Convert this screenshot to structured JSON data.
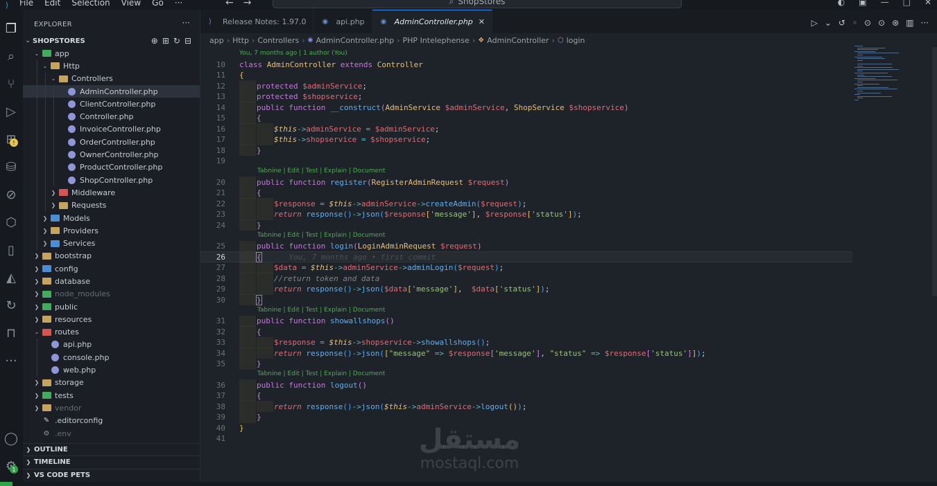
{
  "menu": [
    "File",
    "Edit",
    "Selection",
    "View",
    "Go",
    "···"
  ],
  "search": {
    "text": "ShopStores"
  },
  "explorer": {
    "title": "EXPLORER",
    "root": "SHOPSTORES",
    "tree": [
      {
        "label": "app",
        "depth": 0,
        "open": true,
        "kind": "folder",
        "color": "green"
      },
      {
        "label": "Http",
        "depth": 1,
        "open": true,
        "kind": "folder",
        "color": "yellow"
      },
      {
        "label": "Controllers",
        "depth": 2,
        "open": true,
        "kind": "folder",
        "color": "yellow"
      },
      {
        "label": "AdminController.php",
        "depth": 3,
        "kind": "php",
        "selected": true
      },
      {
        "label": "ClientController.php",
        "depth": 3,
        "kind": "php"
      },
      {
        "label": "Controller.php",
        "depth": 3,
        "kind": "php"
      },
      {
        "label": "InvoiceController.php",
        "depth": 3,
        "kind": "php"
      },
      {
        "label": "OrderController.php",
        "depth": 3,
        "kind": "php"
      },
      {
        "label": "OwnerController.php",
        "depth": 3,
        "kind": "php"
      },
      {
        "label": "ProductController.php",
        "depth": 3,
        "kind": "php"
      },
      {
        "label": "ShopController.php",
        "depth": 3,
        "kind": "php"
      },
      {
        "label": "Middleware",
        "depth": 2,
        "open": false,
        "kind": "folder",
        "color": "red"
      },
      {
        "label": "Requests",
        "depth": 2,
        "open": false,
        "kind": "folder",
        "color": "yellow"
      },
      {
        "label": "Models",
        "depth": 1,
        "open": false,
        "kind": "folder",
        "color": "blue"
      },
      {
        "label": "Providers",
        "depth": 1,
        "open": false,
        "kind": "folder",
        "color": "yellow"
      },
      {
        "label": "Services",
        "depth": 1,
        "open": false,
        "kind": "folder",
        "color": "blue"
      },
      {
        "label": "bootstrap",
        "depth": 0,
        "open": false,
        "kind": "folder",
        "color": "yellow"
      },
      {
        "label": "config",
        "depth": 0,
        "open": false,
        "kind": "folder",
        "color": "blue"
      },
      {
        "label": "database",
        "depth": 0,
        "open": false,
        "kind": "folder",
        "color": "yellow"
      },
      {
        "label": "node_modules",
        "depth": 0,
        "open": false,
        "kind": "folder",
        "color": "green",
        "dim": true
      },
      {
        "label": "public",
        "depth": 0,
        "open": false,
        "kind": "folder",
        "color": "green"
      },
      {
        "label": "resources",
        "depth": 0,
        "open": false,
        "kind": "folder",
        "color": "yellow"
      },
      {
        "label": "routes",
        "depth": 0,
        "open": true,
        "kind": "folder",
        "color": "red"
      },
      {
        "label": "api.php",
        "depth": 1,
        "kind": "php"
      },
      {
        "label": "console.php",
        "depth": 1,
        "kind": "php"
      },
      {
        "label": "web.php",
        "depth": 1,
        "kind": "php"
      },
      {
        "label": "storage",
        "depth": 0,
        "open": false,
        "kind": "folder",
        "color": "yellow"
      },
      {
        "label": "tests",
        "depth": 0,
        "open": false,
        "kind": "folder",
        "color": "green"
      },
      {
        "label": "vendor",
        "depth": 0,
        "open": false,
        "kind": "folder",
        "color": "yellow",
        "dim": true
      },
      {
        "label": ".editorconfig",
        "depth": 0,
        "kind": "config"
      },
      {
        "label": ".env",
        "depth": 0,
        "kind": "gear",
        "dim": true
      }
    ],
    "bottom_sections": [
      "OUTLINE",
      "TIMELINE",
      "VS CODE PETS"
    ]
  },
  "tabs": [
    {
      "label": "Release Notes: 1.97.0",
      "icon": "vscode-icon",
      "active": false
    },
    {
      "label": "api.php",
      "icon": "php-icon",
      "active": false
    },
    {
      "label": "AdminController.php",
      "icon": "php-icon",
      "active": true
    }
  ],
  "breadcrumb": [
    "app",
    "Http",
    "Controllers",
    "AdminController.php",
    "PHP Intelephense",
    "AdminController",
    "login"
  ],
  "editor": {
    "blame_header": "You, 7 months ago | 1 author (You)",
    "lens": "Tabnine | Edit | Test | Explain | Document",
    "inline_blame": "You, 7 months ago • first commit",
    "lines": [
      {
        "n": "10",
        "html": "<span class=\"kw\">class</span> <span class=\"cls\">AdminController</span> <span class=\"kw\">extends</span> <span class=\"cls\">Controller</span>"
      },
      {
        "n": "11",
        "html": "<span class=\"br1\">{</span>"
      },
      {
        "n": "12",
        "indent": 1,
        "html": "<span class=\"kw\">protected</span> <span class=\"var\">$adminService</span>;"
      },
      {
        "n": "13",
        "indent": 1,
        "html": "<span class=\"kw\">protected</span> <span class=\"var\">$shopservice</span>;"
      },
      {
        "n": "14",
        "indent": 1,
        "html": "<span class=\"kw\">public</span> <span class=\"kw\">function</span> <span class=\"fn\">__construct</span><span class=\"br2\">(</span><span class=\"cls\">AdminService</span> <span class=\"var\">$adminService</span>, <span class=\"cls\">ShopService</span> <span class=\"var\">$shopservice</span><span class=\"br2\">)</span>"
      },
      {
        "n": "15",
        "indent": 1,
        "html": "<span class=\"br2\">{</span>"
      },
      {
        "n": "16",
        "indent": 2,
        "html": "<span class=\"this\">$this</span><span class=\"op\">-></span><span class=\"var\">adminService</span> <span class=\"op\">=</span> <span class=\"var\">$adminService</span>;"
      },
      {
        "n": "17",
        "indent": 2,
        "html": "<span class=\"this\">$this</span><span class=\"op\">-></span><span class=\"var\">shopservice</span> <span class=\"op\">=</span> <span class=\"var\">$shopservice</span>;"
      },
      {
        "n": "18",
        "indent": 1,
        "html": "<span class=\"br2\">}</span>"
      },
      {
        "n": "19",
        "indent": 0,
        "html": ""
      },
      {
        "n": "20",
        "indent": 1,
        "lens": true,
        "html": "<span class=\"kw\">public</span> <span class=\"kw\">function</span> <span class=\"fn\">register</span><span class=\"br2\">(</span><span class=\"cls\">RegisterAdminRequest</span> <span class=\"var\">$request</span><span class=\"br2\">)</span>"
      },
      {
        "n": "21",
        "indent": 1,
        "html": "<span class=\"br2\">{</span>"
      },
      {
        "n": "22",
        "indent": 2,
        "html": "<span class=\"var\">$response</span> <span class=\"op\">=</span> <span class=\"this\">$this</span><span class=\"op\">-></span><span class=\"var\">adminService</span><span class=\"op\">-></span><span class=\"fn\">createAdmin</span><span class=\"br3\">(</span><span class=\"var\">$request</span><span class=\"br3\">)</span>;"
      },
      {
        "n": "23",
        "indent": 2,
        "html": "<span class=\"kw2\">return</span> <span class=\"fn\">response</span><span class=\"br3\">()</span><span class=\"op\">-></span><span class=\"fn\">json</span><span class=\"br3\">(</span><span class=\"var\">$response</span><span class=\"br1\">[</span><span class=\"str\">'message'</span><span class=\"br1\">]</span>, <span class=\"var\">$response</span><span class=\"br1\">[</span><span class=\"str\">'status'</span><span class=\"br1\">]</span><span class=\"br3\">)</span>;"
      },
      {
        "n": "24",
        "indent": 1,
        "html": "<span class=\"br2\">}</span>"
      },
      {
        "n": "25",
        "indent": 1,
        "lens": true,
        "html": "<span class=\"kw\">public</span> <span class=\"kw\">function</span> <span class=\"fn\">login</span><span class=\"br2\">(</span><span class=\"cls\">LoginAdminRequest</span> <span class=\"var\">$request</span><span class=\"br2\">)</span>"
      },
      {
        "n": "26",
        "indent": 1,
        "current": true,
        "html": "<span class=\"br2\" style=\"outline:1px solid #8a8f96\">{</span>      <span class=\"ghost\">You, 7 months ago • first commit</span>"
      },
      {
        "n": "27",
        "indent": 2,
        "html": "<span class=\"var\">$data</span> <span class=\"op\">=</span> <span class=\"this\">$this</span><span class=\"op\">-></span><span class=\"var\">adminService</span><span class=\"op\">-></span><span class=\"fn\">adminLogin</span><span class=\"br3\">(</span><span class=\"var\">$request</span><span class=\"br3\">)</span>;"
      },
      {
        "n": "28",
        "indent": 2,
        "html": "<span class=\"cmt\">//return token and data</span>"
      },
      {
        "n": "29",
        "indent": 2,
        "html": "<span class=\"kw2\">return</span> <span class=\"fn\">response</span><span class=\"br3\">()</span><span class=\"op\">-></span><span class=\"fn\">json</span><span class=\"br3\">(</span><span class=\"var\">$data</span><span class=\"br1\">[</span><span class=\"str\">'message'</span><span class=\"br1\">]</span>,  <span class=\"var\">$data</span><span class=\"br1\">[</span><span class=\"str\">'status'</span><span class=\"br1\">]</span><span class=\"br3\">)</span>;"
      },
      {
        "n": "30",
        "indent": 1,
        "html": "<span class=\"br2\" style=\"outline:1px solid #8a8f96\">}</span>"
      },
      {
        "n": "31",
        "indent": 1,
        "lens": true,
        "html": "<span class=\"kw\">public</span> <span class=\"kw\">function</span> <span class=\"fn\">showallshops</span><span class=\"br2\">()</span>"
      },
      {
        "n": "32",
        "indent": 1,
        "html": "<span class=\"br2\">{</span>"
      },
      {
        "n": "33",
        "indent": 2,
        "html": "<span class=\"var\">$response</span> <span class=\"op\">=</span> <span class=\"this\">$this</span><span class=\"op\">-></span><span class=\"var\">shopservice</span><span class=\"op\">-></span><span class=\"fn\">showallshops</span><span class=\"br3\">()</span>;"
      },
      {
        "n": "34",
        "indent": 2,
        "html": "<span class=\"kw2\">return</span> <span class=\"fn\">response</span><span class=\"br3\">()</span><span class=\"op\">-></span><span class=\"fn\">json</span><span class=\"br3\">(</span><span class=\"br1\">[</span><span class=\"str\">\"message\"</span> <span class=\"op\">=></span> <span class=\"var\">$response</span><span class=\"br2\">[</span><span class=\"str\">'message'</span><span class=\"br2\">]</span>, <span class=\"str\">\"status\"</span> <span class=\"op\">=></span> <span class=\"var\">$response</span><span class=\"br2\">[</span><span class=\"str\">'status'</span><span class=\"br2\">]</span><span class=\"br1\">]</span><span class=\"br3\">)</span>;"
      },
      {
        "n": "35",
        "indent": 1,
        "html": "<span class=\"br2\">}</span>"
      },
      {
        "n": "36",
        "indent": 1,
        "lens": true,
        "html": "<span class=\"kw\">public</span> <span class=\"kw\">function</span> <span class=\"fn\">logout</span><span class=\"br2\">()</span>"
      },
      {
        "n": "37",
        "indent": 1,
        "html": "<span class=\"br2\">{</span>"
      },
      {
        "n": "38",
        "indent": 2,
        "html": "<span class=\"kw2\">return</span> <span class=\"fn\">response</span><span class=\"br3\">()</span><span class=\"op\">-></span><span class=\"fn\">json</span><span class=\"br3\">(</span><span class=\"this\">$this</span><span class=\"op\">-></span><span class=\"var\">adminService</span><span class=\"op\">-></span><span class=\"fn\">logout</span><span class=\"br1\">()</span><span class=\"br3\">)</span>;"
      },
      {
        "n": "39",
        "indent": 1,
        "html": "<span class=\"br2\">}</span>"
      },
      {
        "n": "40",
        "indent": 0,
        "html": "<span class=\"br1\">}</span>"
      },
      {
        "n": "41",
        "indent": 0,
        "html": ""
      }
    ]
  },
  "watermark": {
    "arabic": "مستقل",
    "latin": "mostaql.com"
  },
  "colors": {
    "accent": "#3794ff",
    "lens": "#4caf50",
    "remote": "#2fa34a"
  }
}
